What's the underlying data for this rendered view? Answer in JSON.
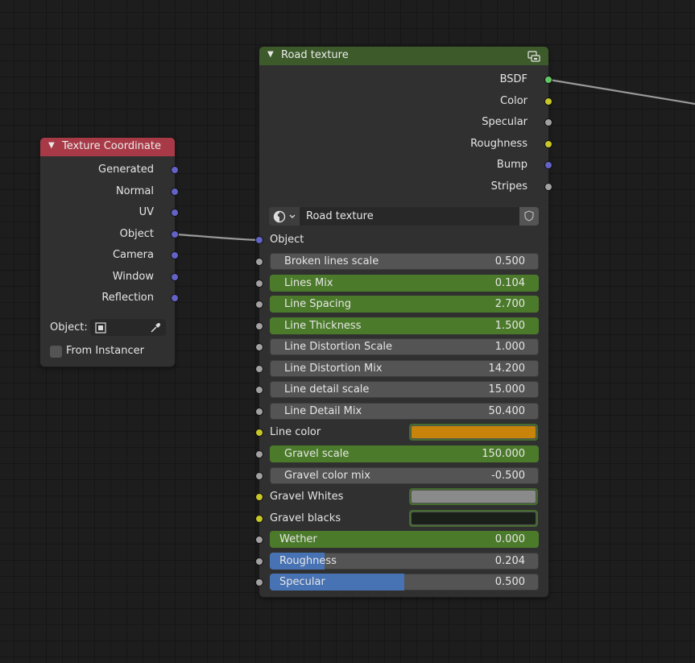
{
  "colors": {
    "socket_vector": "#6363c7",
    "socket_float": "#a1a1a1",
    "socket_color": "#c7c729",
    "socket_shader": "#63c763",
    "field_green": "#4b7b2a",
    "field_blue": "#4772b3",
    "header_red": "#a83a47",
    "header_green": "#3d5a2b"
  },
  "texture_coordinate": {
    "title": "Texture Coordinate",
    "outputs": [
      "Generated",
      "Normal",
      "UV",
      "Object",
      "Camera",
      "Window",
      "Reflection"
    ],
    "object_label": "Object:",
    "from_instancer_label": "From Instancer"
  },
  "road_node": {
    "title": "Road texture",
    "outputs": [
      {
        "label": "BSDF",
        "socket": "shader"
      },
      {
        "label": "Color",
        "socket": "color"
      },
      {
        "label": "Specular",
        "socket": "float"
      },
      {
        "label": "Roughness",
        "socket": "color"
      },
      {
        "label": "Bump",
        "socket": "vector"
      },
      {
        "label": "Stripes",
        "socket": "float"
      }
    ],
    "group_name": "Road texture",
    "object_input_label": "Object",
    "inputs": [
      {
        "type": "float",
        "label": "Broken lines scale",
        "value": "0.500",
        "fill": 0,
        "style": "plain"
      },
      {
        "type": "float",
        "label": "Lines Mix",
        "value": "0.104",
        "fill": 1,
        "style": "green"
      },
      {
        "type": "float",
        "label": "Line Spacing",
        "value": "2.700",
        "fill": 1,
        "style": "green"
      },
      {
        "type": "float",
        "label": "Line Thickness",
        "value": "1.500",
        "fill": 1,
        "style": "green"
      },
      {
        "type": "float",
        "label": "Line Distortion Scale",
        "value": "1.000",
        "fill": 0,
        "style": "plain"
      },
      {
        "type": "float",
        "label": "Line Distortion Mix",
        "value": "14.200",
        "fill": 0,
        "style": "plain"
      },
      {
        "type": "float",
        "label": "Line detail scale",
        "value": "15.000",
        "fill": 0,
        "style": "plain"
      },
      {
        "type": "float",
        "label": "Line Detail Mix",
        "value": "50.400",
        "fill": 0,
        "style": "plain"
      },
      {
        "type": "color",
        "label": "Line color",
        "color": "#c7830a"
      },
      {
        "type": "float",
        "label": "Gravel scale",
        "value": "150.000",
        "fill": 1,
        "style": "green"
      },
      {
        "type": "float",
        "label": "Gravel color mix",
        "value": "-0.500",
        "fill": 0,
        "style": "plain"
      },
      {
        "type": "color",
        "label": "Gravel Whites",
        "color": "#8a8a8a"
      },
      {
        "type": "color",
        "label": "Gravel blacks",
        "color": "#1a1f1a"
      },
      {
        "type": "slider",
        "label": "Wether",
        "value": "0.000",
        "fill": 1,
        "style": "green"
      },
      {
        "type": "slider",
        "label": "Roughness",
        "value": "0.204",
        "fill": 0.204,
        "style": "blue"
      },
      {
        "type": "slider",
        "label": "Specular",
        "value": "0.500",
        "fill": 0.5,
        "style": "blue"
      }
    ]
  }
}
